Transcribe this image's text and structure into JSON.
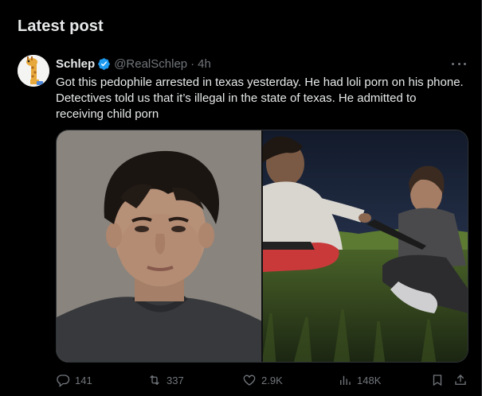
{
  "section": {
    "title": "Latest post"
  },
  "post": {
    "author": {
      "display_name": "Schlep",
      "handle": "@RealSchlep",
      "separator": "·",
      "time": "4h"
    },
    "text": "Got this pedophile arrested in texas yesterday. He had loli porn on his phone. Detectives told us that it’s illegal in the state of texas. He admitted to receiving child porn",
    "media": [
      {
        "alt": "mugshot photo"
      },
      {
        "alt": "outdoor night photo"
      }
    ],
    "stats": {
      "replies": "141",
      "reposts": "337",
      "likes": "2.9K",
      "views": "148K"
    }
  },
  "colors": {
    "background": "#000000",
    "text": "#e7e9ea",
    "muted": "#71767b",
    "verified": "#1d9bf0",
    "border": "#2f3336"
  },
  "icons": [
    "avatar-giraffe-icon",
    "verified-badge-icon",
    "more-options-icon",
    "reply-icon",
    "repost-icon",
    "like-icon",
    "views-icon",
    "bookmark-icon",
    "share-icon"
  ]
}
